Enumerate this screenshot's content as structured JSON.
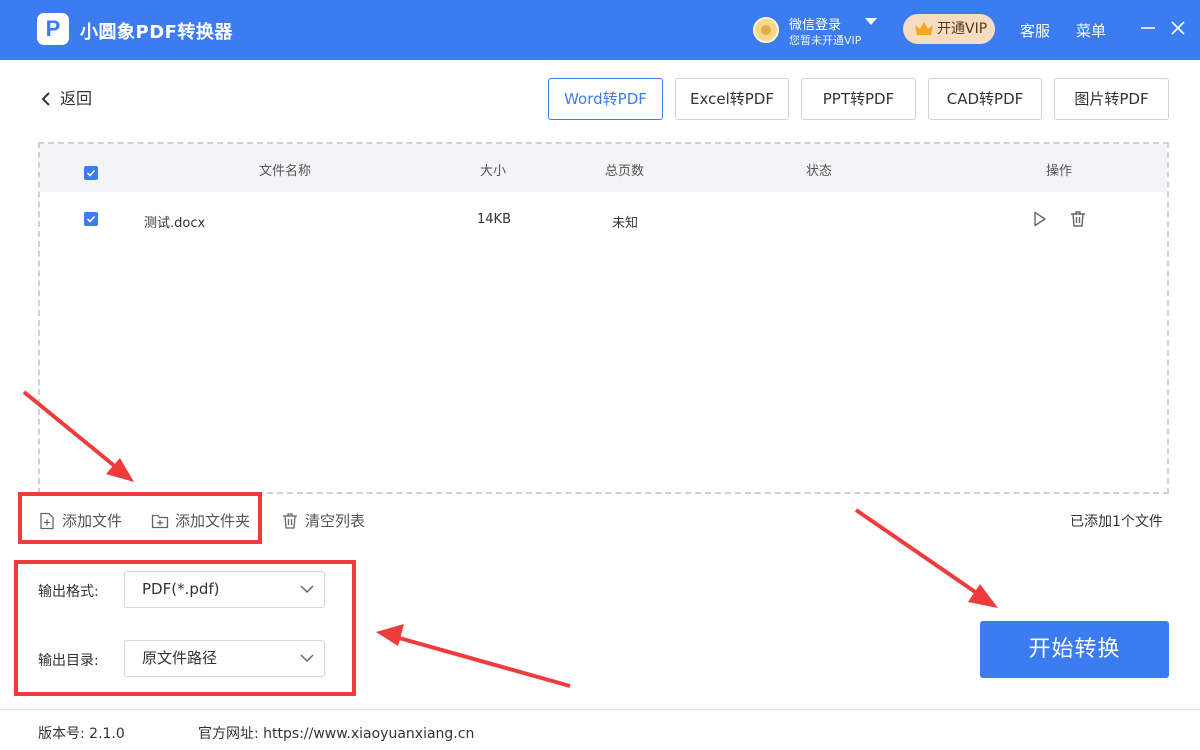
{
  "window": {
    "app_title": "小圆象PDF转换器",
    "logo_letter": "P",
    "login_name": "微信登录",
    "login_sub": "您暂未开通VIP",
    "vip_label": "开通VIP",
    "service_label": "客服",
    "menu_label": "菜单"
  },
  "nav": {
    "back_label": "返回",
    "tabs": [
      {
        "label": "Word转PDF",
        "active": true
      },
      {
        "label": "Excel转PDF",
        "active": false
      },
      {
        "label": "PPT转PDF",
        "active": false
      },
      {
        "label": "CAD转PDF",
        "active": false
      },
      {
        "label": "图片转PDF",
        "active": false
      }
    ]
  },
  "table": {
    "columns": [
      "文件名称",
      "大小",
      "总页数",
      "状态",
      "操作"
    ],
    "rows": [
      {
        "name": "测试.docx",
        "size": "14KB",
        "pages": "未知",
        "status": "",
        "checked": true
      }
    ]
  },
  "actions": {
    "add_file": "添加文件",
    "add_folder": "添加文件夹",
    "clear_list": "清空列表",
    "count_text": "已添加1个文件"
  },
  "output": {
    "format_label": "输出格式:",
    "format_value": "PDF(*.pdf)",
    "dir_label": "输出目录:",
    "dir_value": "原文件路径"
  },
  "start_button": "开始转换",
  "footer": {
    "version": "版本号:  2.1.0",
    "website": "官方网址:  https://www.xiaoyuanxiang.cn"
  },
  "colors": {
    "primary": "#3b7cf0",
    "annotation": "#ee3b3b",
    "vip_bg": "#f6dcc0"
  }
}
